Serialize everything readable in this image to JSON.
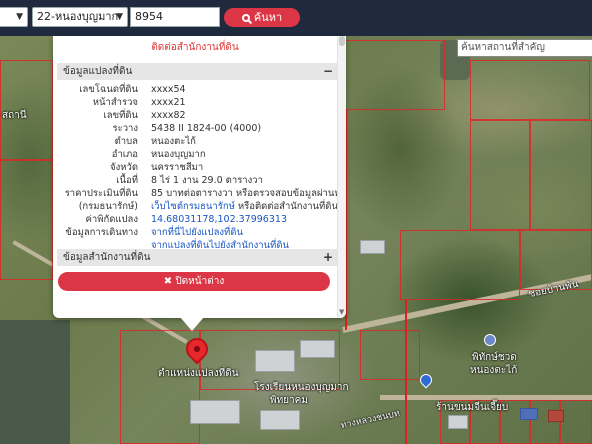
{
  "toolbar": {
    "province_select": "",
    "district_select": "22-หนองบุญมาก",
    "parcel_number_value": "8954",
    "search_button": "ค้นหา"
  },
  "place_search": {
    "placeholder": "ค้นหาสถานที่สำคัญ"
  },
  "popup": {
    "contact_note": "ติดต่อสำนักงานที่ดิน",
    "land_info_header": "ข้อมูลแปลงที่ดิน",
    "land_info_toggle": "−",
    "rows": [
      {
        "label": "เลขโฉนดที่ดิน",
        "value": "xxxx54"
      },
      {
        "label": "หน้าสำรวจ",
        "value": "xxxx21"
      },
      {
        "label": "เลขที่ดิน",
        "value": "xxxx82"
      },
      {
        "label": "ระวาง",
        "value": "5438 II 1824-00 (4000)"
      },
      {
        "label": "ตำบล",
        "value": "หนองตะไก้"
      },
      {
        "label": "อำเภอ",
        "value": "หนองบุญมาก"
      },
      {
        "label": "จังหวัด",
        "value": "นครราชสีมา"
      },
      {
        "label": "เนื้อที่",
        "value": "8 ไร่ 1 งาน 29.0 ตารางวา"
      },
      {
        "label": "ราคาประเมินที่ดิน",
        "value": "85 บาทต่อตารางวา หรือตรวจสอบข้อมูลผ่านทาง"
      },
      {
        "label": "(กรมธนารักษ์)",
        "value": "เว็บไซต์กรมธนารักษ์",
        "value2": " หรือติดต่อสำนักงานที่ดิน"
      },
      {
        "label": "ค่าพิกัดแปลง",
        "value": "14.68031178,102.37996313"
      },
      {
        "label": "ข้อมูลการเดินทาง",
        "value": "จากที่นี่ไปยังแปลงที่ดิน"
      },
      {
        "label": "",
        "value": "จากแปลงที่ดินไปยังสำนักงานที่ดิน"
      }
    ],
    "office_header": "ข้อมูลสำนักงานที่ดิน",
    "office_toggle": "+",
    "close_button": "ปิดหน้าต่าง"
  },
  "map": {
    "labels": [
      {
        "text": "ตำแหน่งแปลงที่ดิน"
      },
      {
        "text": "โรงเรียนหนองบุญมาก"
      },
      {
        "text": "พิทยาคม"
      },
      {
        "text": "พิทักษ์ชวด"
      },
      {
        "text": "หนองตะไก้"
      },
      {
        "text": "ซอยบ้านพัน"
      },
      {
        "text": "ร้านขนมจีนเจี๊ยบ"
      },
      {
        "text": "ทางหลวงชนบท"
      },
      {
        "text": "สถานี"
      }
    ]
  },
  "colors": {
    "topbar": "#202a3e",
    "accent": "#dc3545",
    "link": "#1a56c4",
    "parcel_line": "#e02020"
  }
}
